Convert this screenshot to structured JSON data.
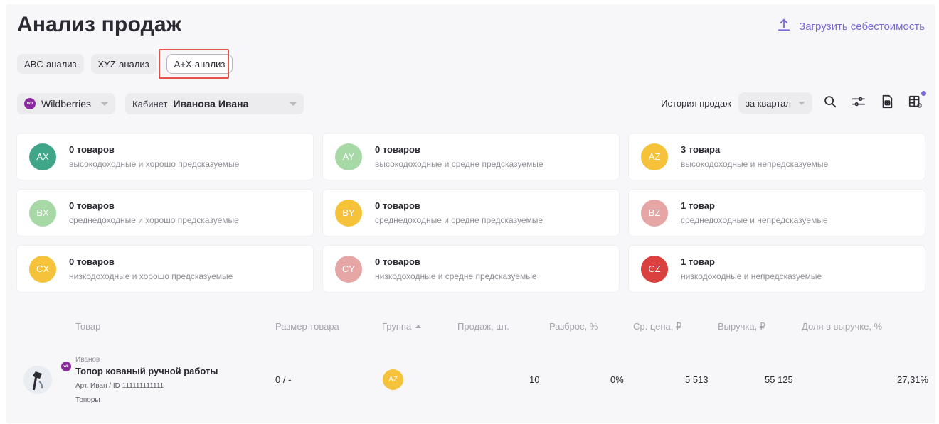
{
  "page": {
    "title": "Анализ продаж",
    "upload_label": "Загрузить себестоимость"
  },
  "tabs": [
    {
      "label": "ABC-анализ"
    },
    {
      "label": "XYZ-анализ"
    },
    {
      "label": "A+X-анализ",
      "active": true
    }
  ],
  "filters": {
    "marketplace": "Wildberries",
    "marketplace_icon": "wb",
    "cabinet_label": "Кабинет",
    "cabinet_value": "Иванова Ивана",
    "history_label": "История продаж",
    "period": "за квартал"
  },
  "cards": [
    {
      "code": "AX",
      "count": "0 товаров",
      "desc": "высокодоходные и хорошо предсказуемые",
      "color": "#3fa68a"
    },
    {
      "code": "AY",
      "count": "0 товаров",
      "desc": "высокодоходные и средне предсказуемые",
      "color": "#a6d9a6"
    },
    {
      "code": "AZ",
      "count": "3 товара",
      "desc": "высокодоходные и непредсказуемые",
      "color": "#f5c23a"
    },
    {
      "code": "BX",
      "count": "0 товаров",
      "desc": "среднедоходные и хорошо предсказуемые",
      "color": "#a6d9a6"
    },
    {
      "code": "BY",
      "count": "0 товаров",
      "desc": "среднедоходные и средне предсказуемые",
      "color": "#f5c23a"
    },
    {
      "code": "BZ",
      "count": "1 товар",
      "desc": "среднедоходные и непредсказуемые",
      "color": "#e6a6a6"
    },
    {
      "code": "CX",
      "count": "0 товаров",
      "desc": "низкодоходные и хорошо предсказуемые",
      "color": "#f5c23a"
    },
    {
      "code": "CY",
      "count": "0 товаров",
      "desc": "низкодоходные и средне предсказуемые",
      "color": "#e6a6a6"
    },
    {
      "code": "CZ",
      "count": "1 товар",
      "desc": "низкодоходные и непредсказуемые",
      "color": "#d9413e"
    }
  ],
  "table": {
    "headers": {
      "product": "Товар",
      "size": "Размер товара",
      "group": "Группа",
      "sales": "Продаж, шт.",
      "spread": "Разброс, %",
      "avg_price": "Ср. цена, ₽",
      "revenue": "Выручка, ₽",
      "share": "Доля в выручке, %"
    },
    "rows": [
      {
        "brand": "Иванов",
        "name": "Топор кованый ручной работы",
        "article": "Арт. Иван / ID 111111111111",
        "category": "Топоры",
        "size": "0 / -",
        "group": "AZ",
        "sales": "10",
        "spread": "0%",
        "avg_price": "5 513",
        "revenue": "55 125",
        "share": "27,31%"
      }
    ]
  }
}
